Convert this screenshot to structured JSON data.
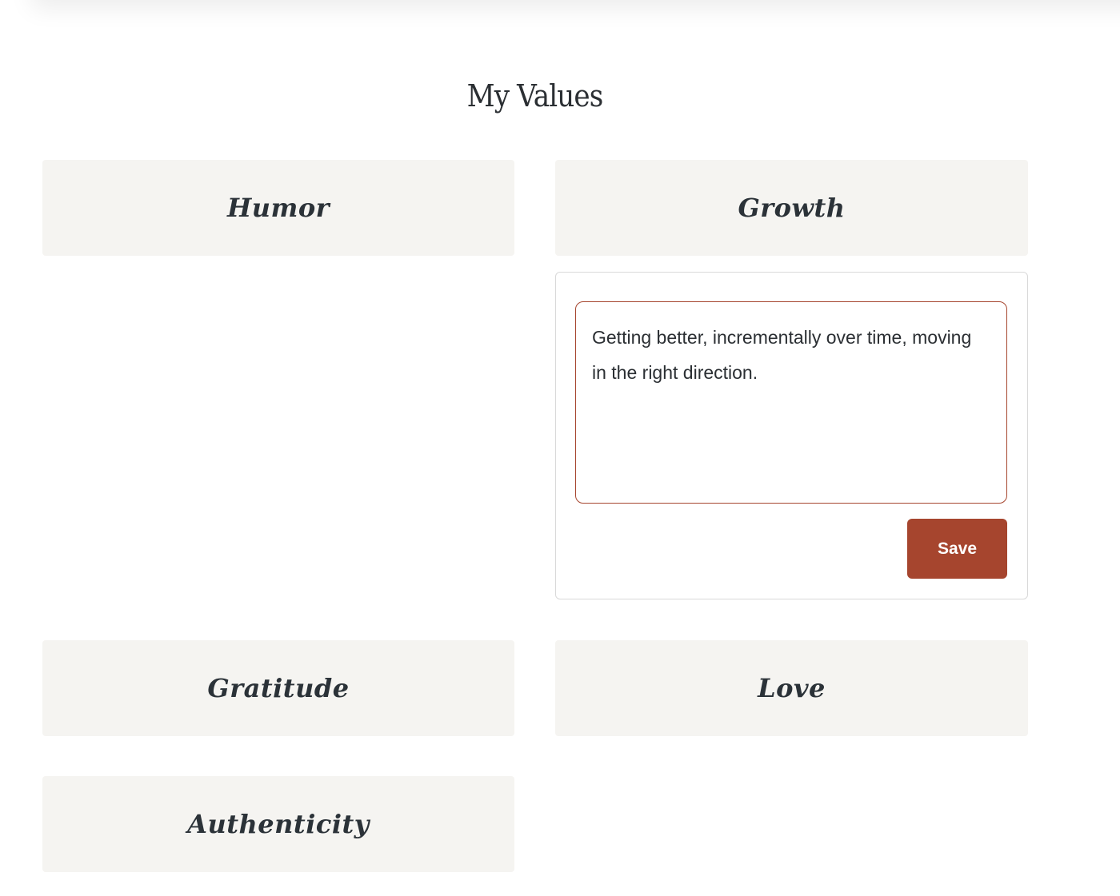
{
  "page": {
    "title": "My Values"
  },
  "values": [
    {
      "label": "Humor"
    },
    {
      "label": "Growth"
    },
    {
      "label": "Gratitude"
    },
    {
      "label": "Love"
    },
    {
      "label": "Authenticity"
    }
  ],
  "editor": {
    "value_label": "Growth",
    "text": "Getting better, incrementally over time, moving in the right direction.",
    "save_label": "Save"
  },
  "colors": {
    "accent": "#a6452e",
    "card_background": "#f5f4f1",
    "text": "#2b2f33"
  }
}
